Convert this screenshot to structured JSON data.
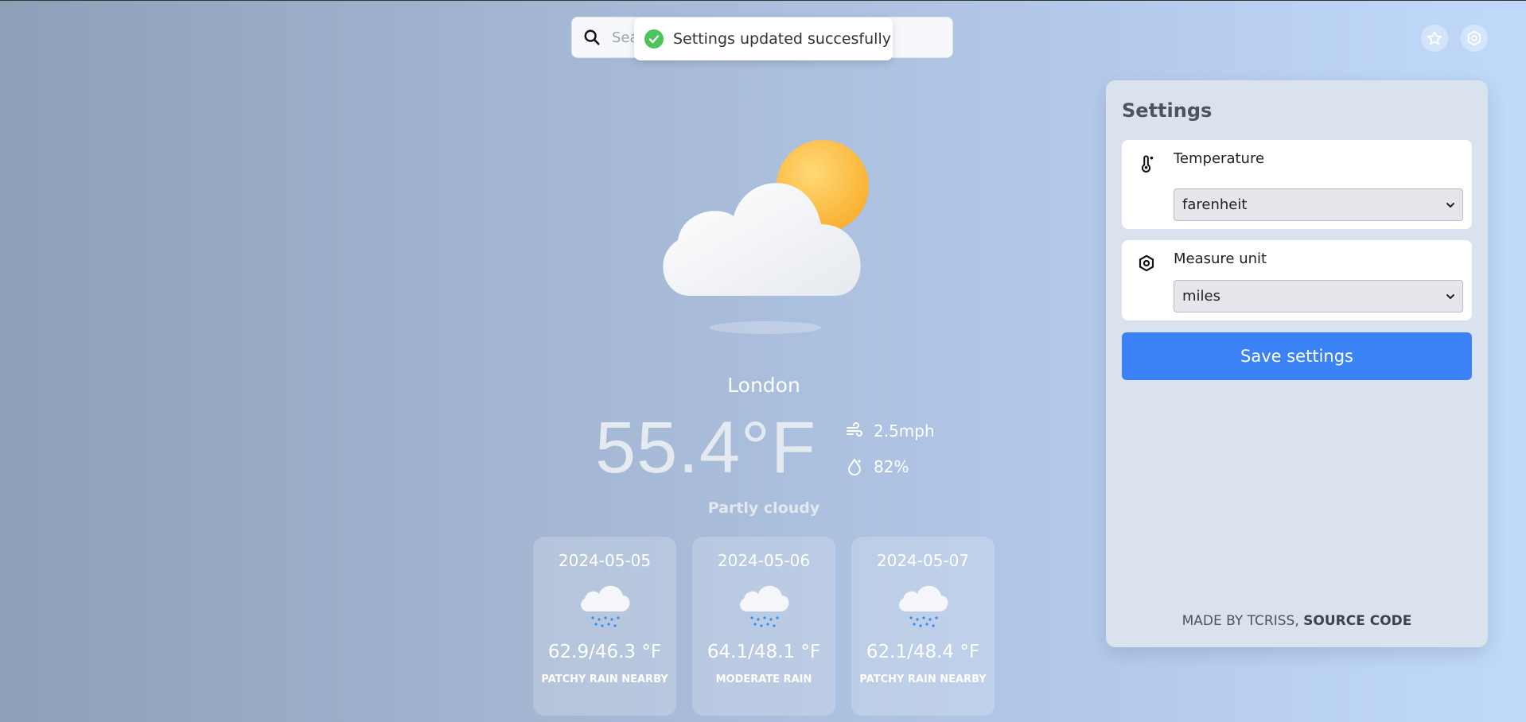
{
  "search": {
    "placeholder": "Search"
  },
  "toast": {
    "message": "Settings updated succesfully"
  },
  "weather": {
    "city": "London",
    "temperature": "55.4°F",
    "wind": "2.5mph",
    "humidity": "82%",
    "condition": "Partly cloudy",
    "main_icon": "partly-cloudy-icon"
  },
  "forecast": [
    {
      "date": "2024-05-05",
      "range": "62.9/46.3 °F",
      "condition": "PATCHY RAIN NEARBY",
      "icon": "rain-cloud-icon"
    },
    {
      "date": "2024-05-06",
      "range": "64.1/48.1 °F",
      "condition": "MODERATE RAIN",
      "icon": "rain-cloud-icon"
    },
    {
      "date": "2024-05-07",
      "range": "62.1/48.4 °F",
      "condition": "PATCHY RAIN NEARBY",
      "icon": "rain-cloud-icon"
    }
  ],
  "settings": {
    "title": "Settings",
    "temperature": {
      "label": "Temperature",
      "value": "farenheit",
      "icon": "thermometer-icon"
    },
    "measure": {
      "label": "Measure unit",
      "value": "miles",
      "icon": "gear-icon"
    },
    "save_label": "Save settings",
    "footer_prefix": "MADE BY TCRISS, ",
    "footer_link": "SOURCE CODE"
  },
  "colors": {
    "accent": "#3b82f6",
    "success": "#4bc45a",
    "sun": "#fbb437"
  }
}
